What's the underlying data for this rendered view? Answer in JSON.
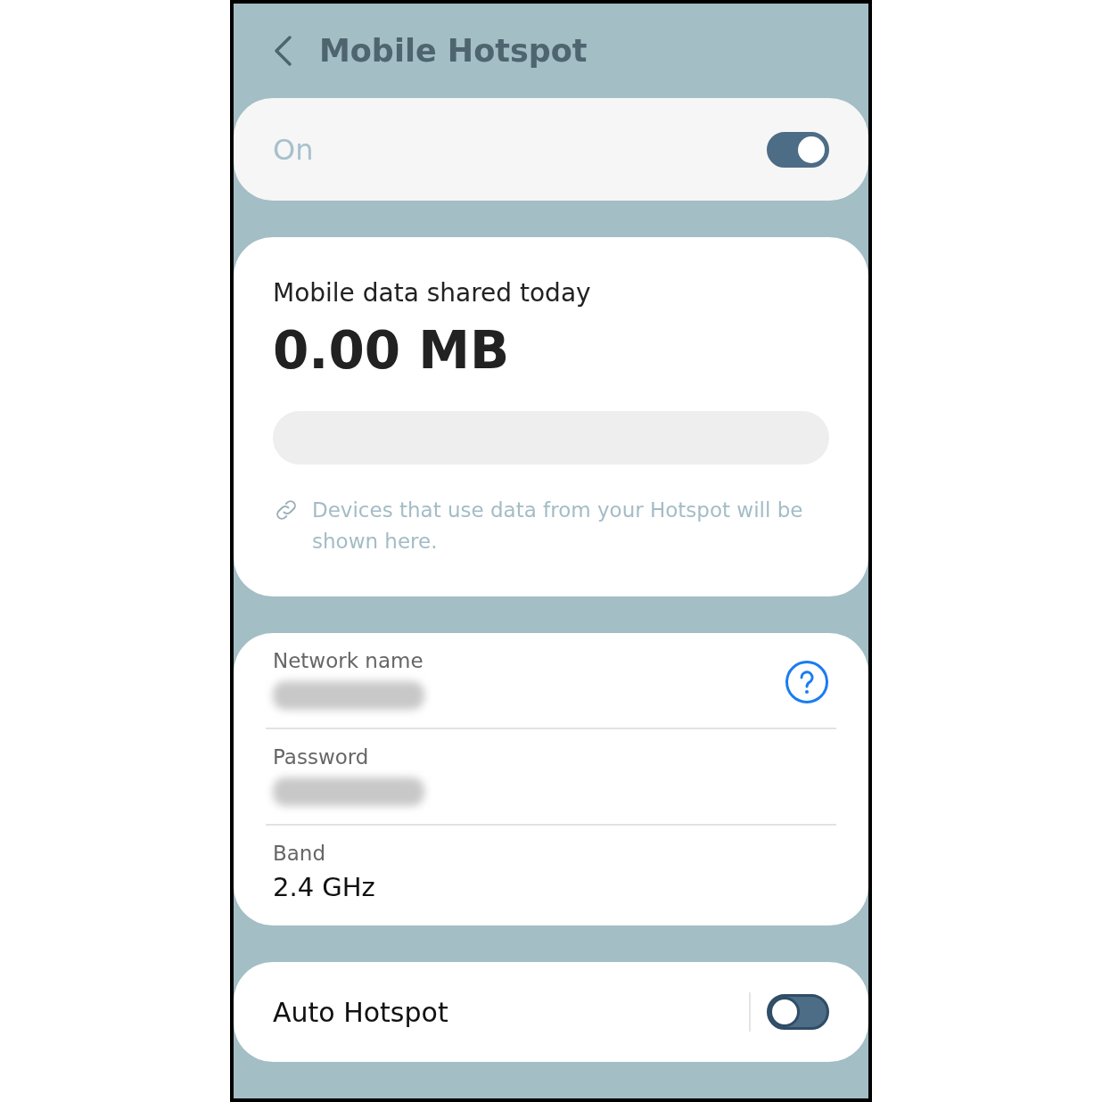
{
  "header": {
    "title": "Mobile Hotspot"
  },
  "master_switch": {
    "label": "On",
    "on": true
  },
  "usage": {
    "label": "Mobile data shared today",
    "amount": "0.00 MB",
    "level": 0,
    "note": "Devices that use data from your Hotspot will be shown here."
  },
  "settings": [
    {
      "label": "Network name",
      "value_hidden": true,
      "help": true
    },
    {
      "label": "Password",
      "value_hidden": true,
      "help": false
    },
    {
      "label": "Band",
      "value": "2.4 GHz",
      "value_hidden": false,
      "help": false
    }
  ],
  "auto_hotspot": {
    "label": "Auto Hotspot",
    "on": false
  }
}
